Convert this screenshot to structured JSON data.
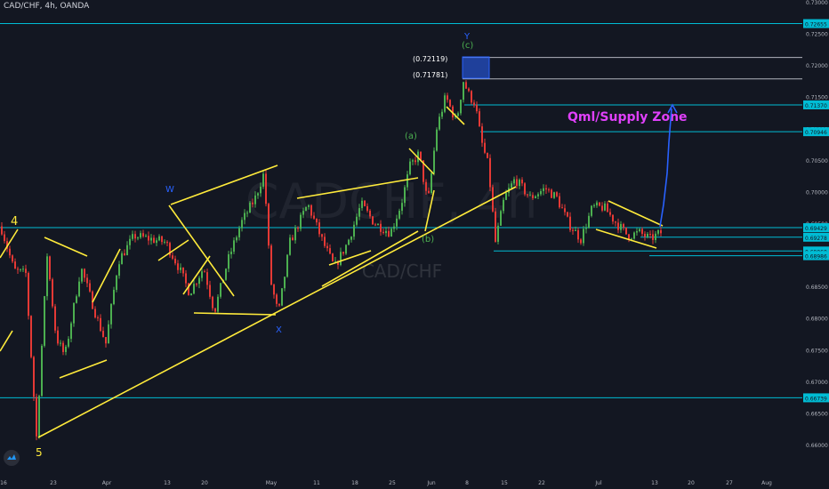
{
  "header": {
    "symbol_title": "CAD/CHF, 4h, OANDA"
  },
  "watermark": {
    "big": "CADCHF, 4h",
    "small": "CAD/CHF"
  },
  "colors": {
    "background": "#131722",
    "up": "#26a69a",
    "up_candle": "#4caf50",
    "down_candle": "#e53935",
    "trendline": "#ffeb3b",
    "level_line": "#00bcd4",
    "fib_line": "#b2b5be",
    "zone_label": "#e040fb",
    "arrow": "#2962ff",
    "wave_blue": "#2962ff",
    "wave_green": "#4caf50",
    "wave_yellow": "#ffeb3b"
  },
  "annotations": {
    "zone_label": "Qml/Supply Zone",
    "fib_upper": "(0.72119)",
    "fib_lower": "(0.71781)",
    "wave_4": "4",
    "wave_5": "5",
    "wave_w": "W",
    "wave_x": "X",
    "wave_y": "Y",
    "wave_a": "(a)",
    "wave_b": "(b)",
    "wave_c": "(c)"
  },
  "price_axis": {
    "ticks": [
      "0.73000",
      "0.72500",
      "0.72000",
      "0.71500",
      "0.71000",
      "0.70500",
      "0.70000",
      "0.69500",
      "0.69000",
      "0.68500",
      "0.68000",
      "0.67500",
      "0.67000",
      "0.66500",
      "0.66000"
    ],
    "highlights": [
      {
        "label": "0.72655",
        "value": 0.72655
      },
      {
        "label": "0.71370",
        "value": 0.7137
      },
      {
        "label": "0.70946",
        "value": 0.70946
      },
      {
        "label": "0.69429",
        "value": 0.69429
      },
      {
        "label": "0.69278",
        "value": 0.69278
      },
      {
        "label": "0.69060",
        "value": 0.6906
      },
      {
        "label": "0.68986",
        "value": 0.68986
      },
      {
        "label": "0.66739",
        "value": 0.66739
      }
    ]
  },
  "time_axis": {
    "ticks": [
      "16",
      "23",
      "Apr",
      "13",
      "20",
      "May",
      "11",
      "18",
      "25",
      "Jun",
      "8",
      "15",
      "22",
      "Jul",
      "13",
      "20",
      "27",
      "Aug"
    ]
  },
  "levels": {
    "top": 0.72655,
    "qml": 0.7137,
    "r1": 0.70946,
    "neck": 0.69429,
    "s1": 0.69278,
    "s2": 0.6906,
    "s3": 0.68986,
    "bottom": 0.66739,
    "fib_upper": 0.72119,
    "fib_lower": 0.71781
  }
}
